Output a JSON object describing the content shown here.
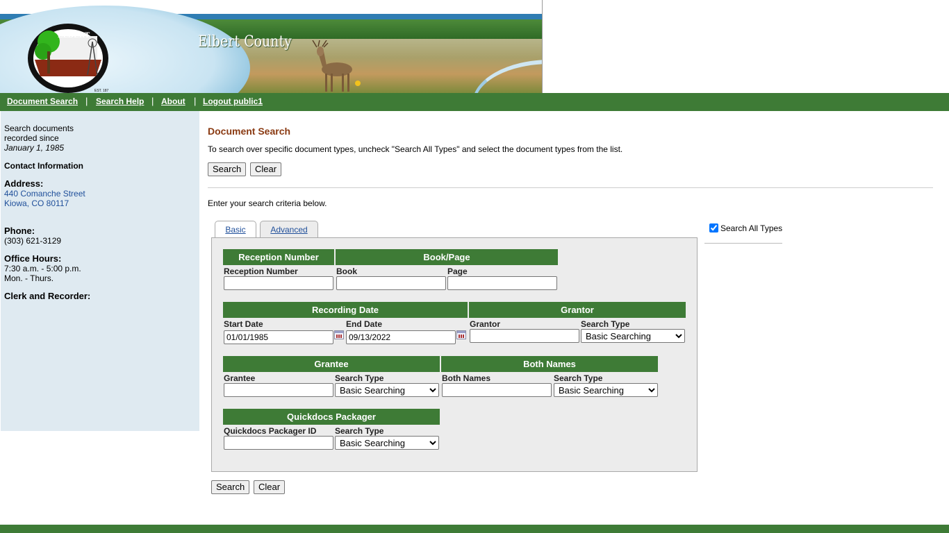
{
  "banner": {
    "title": "Elbert County",
    "seal_text": [
      "ELBERT",
      "COUNTY",
      "EST. 1874"
    ]
  },
  "nav": {
    "items": [
      "Document Search",
      "Search Help",
      "About",
      "Logout public1"
    ],
    "separator": "|"
  },
  "sidebar": {
    "intro_line1": "Search documents",
    "intro_line2": "recorded since",
    "intro_date": "January 1, 1985",
    "contact_heading": "Contact Information",
    "address_heading": "Address:",
    "address_line1": "440 Comanche Street",
    "address_line2": "Kiowa, CO 80117",
    "phone_heading": "Phone:",
    "phone": "(303) 621-3129",
    "hours_heading": "Office Hours:",
    "hours_line1": "7:30 a.m. - 5:00 p.m.",
    "hours_line2": "Mon. - Thurs.",
    "clerk_heading": "Clerk and Recorder:"
  },
  "main": {
    "title": "Document Search",
    "description": "To search over specific document types, uncheck \"Search All Types\" and select the document types from the list.",
    "search_button": "Search",
    "clear_button": "Clear",
    "criteria_text": "Enter your search criteria below."
  },
  "tabs": {
    "basic": "Basic",
    "advanced": "Advanced"
  },
  "search_all_types": {
    "label": "Search All Types",
    "checked": true
  },
  "form": {
    "reception": {
      "header": "Reception Number",
      "field_label": "Reception Number",
      "value": ""
    },
    "bookpage": {
      "header": "Book/Page",
      "book_label": "Book",
      "page_label": "Page",
      "book_value": "",
      "page_value": ""
    },
    "recording_date": {
      "header": "Recording Date",
      "start_label": "Start Date",
      "start_value": "01/01/1985",
      "end_label": "End Date",
      "end_value": "09/13/2022"
    },
    "grantor": {
      "header": "Grantor",
      "field_label": "Grantor",
      "type_label": "Search Type",
      "type_value": "Basic Searching"
    },
    "grantee": {
      "header": "Grantee",
      "field_label": "Grantee",
      "type_label": "Search Type",
      "type_value": "Basic Searching"
    },
    "both_names": {
      "header": "Both Names",
      "field_label": "Both Names",
      "type_label": "Search Type",
      "type_value": "Basic Searching"
    },
    "quickdocs": {
      "header": "Quickdocs Packager",
      "field_label": "Quickdocs Packager ID",
      "type_label": "Search Type",
      "type_value": "Basic Searching"
    }
  },
  "colors": {
    "nav_green": "#3e7b36",
    "title_brown": "#8a3a12",
    "sidebar_bg": "#dfeaf1",
    "panel_bg": "#ececec"
  }
}
